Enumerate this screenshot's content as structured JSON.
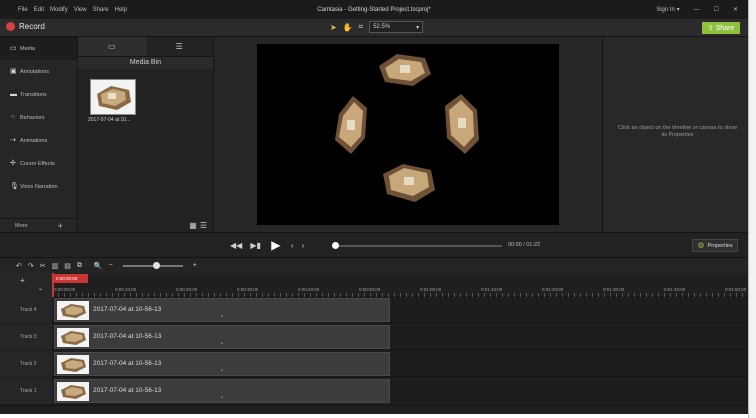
{
  "window": {
    "title": "Camtasia - Getting-Started Project.tscproj*",
    "menus": [
      "File",
      "Edit",
      "Modify",
      "View",
      "Share",
      "Help"
    ],
    "signin": "Sign In ▾"
  },
  "toolbar": {
    "record_label": "Record",
    "zoom": "52.5%",
    "share_label": "Share"
  },
  "sidebar": {
    "items": [
      {
        "label": "Media",
        "icon": "media-icon"
      },
      {
        "label": "Annotations",
        "icon": "annotations-icon"
      },
      {
        "label": "Transitions",
        "icon": "transitions-icon"
      },
      {
        "label": "Behaviors",
        "icon": "behaviors-icon"
      },
      {
        "label": "Animations",
        "icon": "animations-icon"
      },
      {
        "label": "Cursor Effects",
        "icon": "cursor-effects-icon"
      },
      {
        "label": "Voice Narration",
        "icon": "voice-narration-icon"
      }
    ],
    "more_label": "More"
  },
  "media_bin": {
    "title": "Media Bin",
    "items": [
      {
        "caption": "2017-07-04 at 10..."
      }
    ]
  },
  "properties": {
    "hint": "Click an object on the timeline or canvas to show its Properties",
    "button_label": "Properties"
  },
  "playback": {
    "time": "00:00 / 01:22"
  },
  "timeline": {
    "playhead_time": "0:00:00;00",
    "ticks": [
      "0:00:00;00",
      "0:00:10;00",
      "0:00:20;00",
      "0:00:30;00",
      "0:00:40;00",
      "0:00:50;00",
      "0:01:00;00",
      "0:01:10;00",
      "0:01:20;00",
      "0:01:30;00",
      "0:01:40;00",
      "0:01:50;00"
    ],
    "tracks": [
      {
        "name": "Track 4",
        "clip": "2017-07-04 at 10-56-13"
      },
      {
        "name": "Track 3",
        "clip": "2017-07-04 at 10-56-13"
      },
      {
        "name": "Track 2",
        "clip": "2017-07-04 at 10-56-13"
      },
      {
        "name": "Track 1",
        "clip": "2017-07-04 at 10-56-13"
      }
    ]
  },
  "colors": {
    "accent": "#8fc13f",
    "record": "#d94040",
    "playhead": "#cc3333"
  }
}
